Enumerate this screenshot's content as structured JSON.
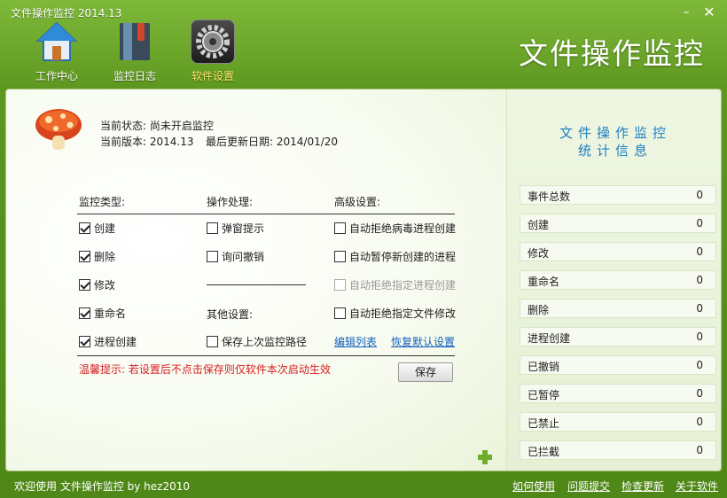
{
  "window": {
    "title": "文件操作监控 2014.13",
    "app_name": "文件操作监控",
    "minimize": "–",
    "close": "✕"
  },
  "toolbar": {
    "items": [
      {
        "label": "工作中心",
        "icon": "home-icon",
        "active": false
      },
      {
        "label": "监控日志",
        "icon": "log-book-icon",
        "active": false
      },
      {
        "label": "软件设置",
        "icon": "settings-gear-icon",
        "active": true
      }
    ]
  },
  "status": {
    "current_state": "当前状态: 尚未开启监控",
    "version": "当前版本: 2014.13",
    "last_update": "最后更新日期: 2014/01/20"
  },
  "settings": {
    "monitor_type_header": "监控类型:",
    "operation_header": "操作处理:",
    "advanced_header": "高级设置:",
    "other_header": "其他设置:",
    "monitor_types": [
      {
        "label": "创建",
        "checked": true
      },
      {
        "label": "删除",
        "checked": true
      },
      {
        "label": "修改",
        "checked": true
      },
      {
        "label": "重命名",
        "checked": true
      },
      {
        "label": "进程创建",
        "checked": true
      }
    ],
    "operations": [
      {
        "label": "弹窗提示",
        "checked": false
      },
      {
        "label": "询问撤销",
        "checked": false
      }
    ],
    "advanced": [
      {
        "label": "自动拒绝病毒进程创建",
        "checked": false,
        "disabled": false
      },
      {
        "label": "自动暂停新创建的进程",
        "checked": false,
        "disabled": false
      },
      {
        "label": "自动拒绝指定进程创建",
        "checked": false,
        "disabled": true
      },
      {
        "label": "自动拒绝指定文件修改",
        "checked": false,
        "disabled": false
      }
    ],
    "other": [
      {
        "label": "保存上次监控路径",
        "checked": false
      }
    ],
    "edit_list_link": "编辑列表",
    "restore_default_link": "恢复默认设置",
    "tip": "温馨提示: 若设置后不点击保存则仅软件本次启动生效",
    "save_button": "保存"
  },
  "stats": {
    "title_line1": "文件操作监控",
    "title_line2": "统计信息",
    "rows": [
      {
        "label": "事件总数",
        "value": "0"
      },
      {
        "label": "创建",
        "value": "0"
      },
      {
        "label": "修改",
        "value": "0"
      },
      {
        "label": "重命名",
        "value": "0"
      },
      {
        "label": "删除",
        "value": "0"
      },
      {
        "label": "进程创建",
        "value": "0"
      },
      {
        "label": "已撤销",
        "value": "0"
      },
      {
        "label": "已暂停",
        "value": "0"
      },
      {
        "label": "已禁止",
        "value": "0"
      },
      {
        "label": "已拦截",
        "value": "0"
      }
    ]
  },
  "footer": {
    "welcome": "欢迎使用 文件操作监控 by hez2010",
    "links": [
      "如何使用",
      "问题提交",
      "检查更新",
      "关于软件"
    ]
  },
  "colors": {
    "accent_green": "#5d971f",
    "active_tab_text": "#ffe86b",
    "stats_title": "#1f7fc0",
    "tip_red": "#d42020",
    "link_blue": "#1560bd"
  }
}
